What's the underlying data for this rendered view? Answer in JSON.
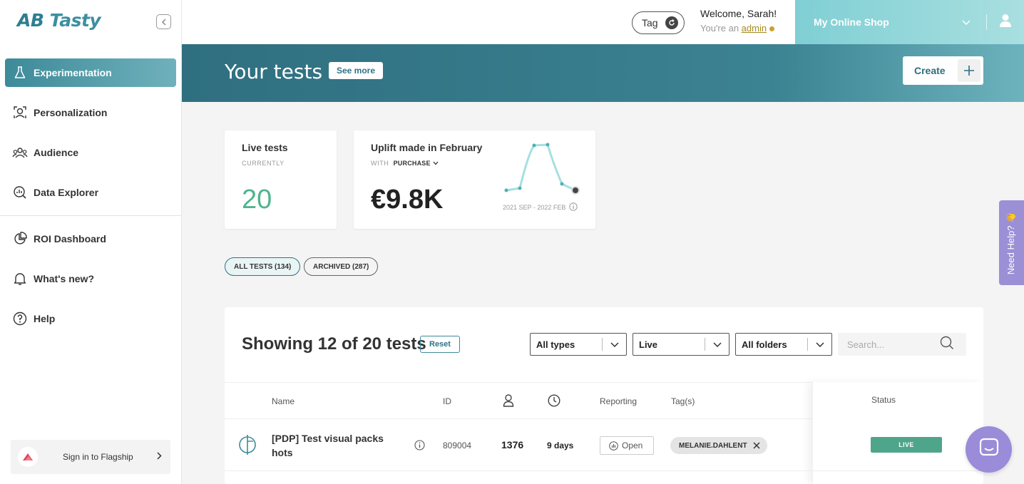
{
  "brand": {
    "logo_ab": "AB",
    "logo_rest": " Tasty"
  },
  "sidebar": {
    "items": [
      {
        "label": "Experimentation",
        "icon": "flask-icon"
      },
      {
        "label": "Personalization",
        "icon": "person-target-icon"
      },
      {
        "label": "Audience",
        "icon": "audience-icon"
      },
      {
        "label": "Data Explorer",
        "icon": "chart-magnifier-icon"
      },
      {
        "label": "ROI Dashboard",
        "icon": "pie-chart-icon"
      },
      {
        "label": "What's new?",
        "icon": "bell-icon"
      },
      {
        "label": "Help",
        "icon": "question-icon"
      }
    ],
    "flagship": "Sign in to Flagship"
  },
  "topbar": {
    "tag_label": "Tag",
    "welcome": "Welcome, Sarah!",
    "role_prefix": "You're an ",
    "role": "admin",
    "shop": "My Online Shop"
  },
  "banner": {
    "title": "Your tests",
    "see_more": "See more",
    "create": "Create"
  },
  "cards": {
    "live": {
      "title": "Live tests",
      "sub": "CURRENTLY",
      "value": "20"
    },
    "uplift": {
      "title": "Uplift made in February",
      "with": "WITH",
      "metric": "PURCHASE",
      "value": "€9.8K",
      "range": "2021 SEP - 2022 FEB"
    }
  },
  "filters": {
    "all": "ALL TESTS (134)",
    "archived": "ARCHIVED (287)"
  },
  "table": {
    "showing": "Showing 12 of 20 tests",
    "reset": "Reset",
    "selects": [
      "All types",
      "Live",
      "All folders"
    ],
    "search_placeholder": "Search...",
    "headers": {
      "name": "Name",
      "id": "ID",
      "reporting": "Reporting",
      "tags": "Tag(s)",
      "status": "Status"
    },
    "rows": [
      {
        "name": "[PDP] Test visual packs hots",
        "id": "809004",
        "users": "1376",
        "days": "9 days",
        "report": "Open",
        "tag": "MELANIE.DAHLENT",
        "status": "LIVE"
      }
    ]
  },
  "help": {
    "need_help": "Need Help? 👋"
  },
  "colors": {
    "accent": "#3d8a99",
    "live": "#4fa58a",
    "help": "#9b8fd6"
  }
}
